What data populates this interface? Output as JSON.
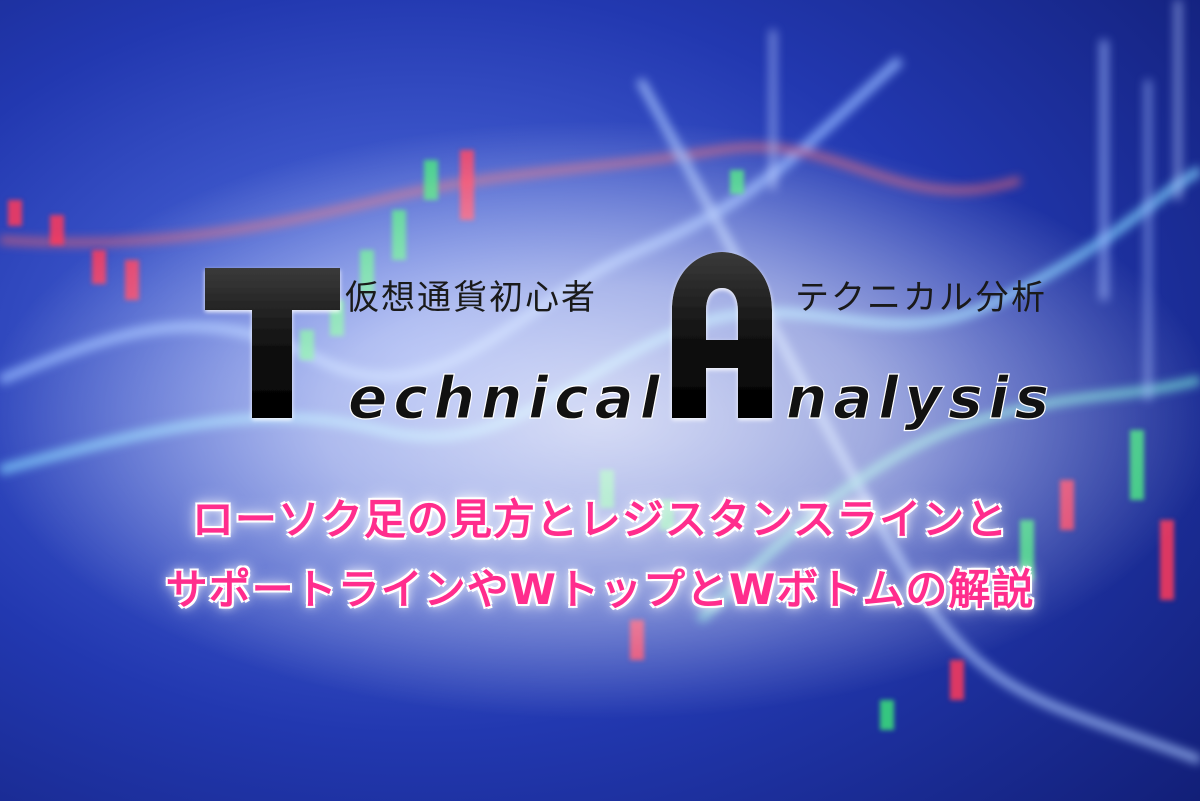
{
  "header": {
    "subtitle_left": "仮想通貨初心者",
    "subtitle_right": "テクニカル分析",
    "logo_big_t": "T",
    "logo_word_1": "echnical",
    "logo_big_a": "A",
    "logo_word_2": "nalysis"
  },
  "headline": {
    "line1": "ローソク足の見方とレジスタンスラインと",
    "line2": "サポートラインやWトップとWボトムの解説"
  },
  "colors": {
    "background": "#1d2f9a",
    "headline": "#ff2d8d",
    "logo": "#111111",
    "candle_up": "#39e07a",
    "candle_down": "#ff3a5a"
  }
}
